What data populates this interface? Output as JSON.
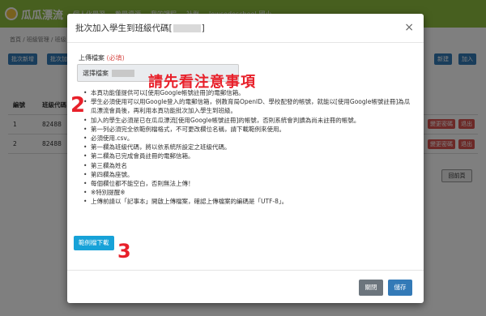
{
  "app": {
    "brand": "瓜瓜漂流",
    "nav": [
      "個人化學習",
      "教學資源",
      "我的課程",
      "社群",
      "lowcodeschool-國小"
    ]
  },
  "background": {
    "breadcrumb": "首頁 / 班級管理 / 班級",
    "buttons": {
      "batch_add": "批次新增",
      "batch_add2": "批次加入",
      "new": "新建",
      "join": "加入"
    },
    "table_headers": [
      "編號",
      "班級代碼"
    ],
    "rows": [
      {
        "no": "1",
        "code": "82488"
      },
      {
        "no": "2",
        "code": "82488"
      }
    ],
    "row_actions": {
      "change": "變更密碼",
      "remove": "退出"
    },
    "prev_page": "回前頁"
  },
  "modal": {
    "title_prefix": "批次加入學生到班級代碼[",
    "title_suffix": "]",
    "close": "×",
    "field_label": "上傳檔案",
    "required": "(必填)",
    "file_value": "選擇檔案",
    "annotation_main": "請先看注意事項",
    "annotation_2": "2",
    "annotation_3": "3",
    "notes": [
      "本頁功能僅提供可以[使用Google帳號註冊]的電郵信箱。",
      "學生必須使用可以用Google登入的電郵信箱，例教育局OpenID、學校配發的帳號，就能以[使用Google帳號註冊]為瓜瓜漂流會員後，再利用本頁功能批次加入學生到班級。",
      "加入的學生必須是已在瓜瓜漂流[使用Google帳號註冊]的帳號，否則系統會判讀為尚未註冊的帳號。",
      "第一列必須完全依範例檔格式，不可更改欄位名稱，請下載範例來使用。",
      "必須使用.csv。",
      "第一欄為班級代碼，將以依系統所設定之班級代碼。",
      "第二欄為已完成會員註冊的電郵信箱。",
      "第三欄為姓名",
      "第四欄為座號。",
      "每個欄位都不能空白，否則無法上傳！",
      "※特別提醒※",
      "上傳前請以「記事本」開啟上傳檔案，確認上傳檔案的編碼是「UTF-8」。"
    ],
    "sample_button": "範例檔下載",
    "footer": {
      "close": "關閉",
      "save": "儲存"
    }
  }
}
